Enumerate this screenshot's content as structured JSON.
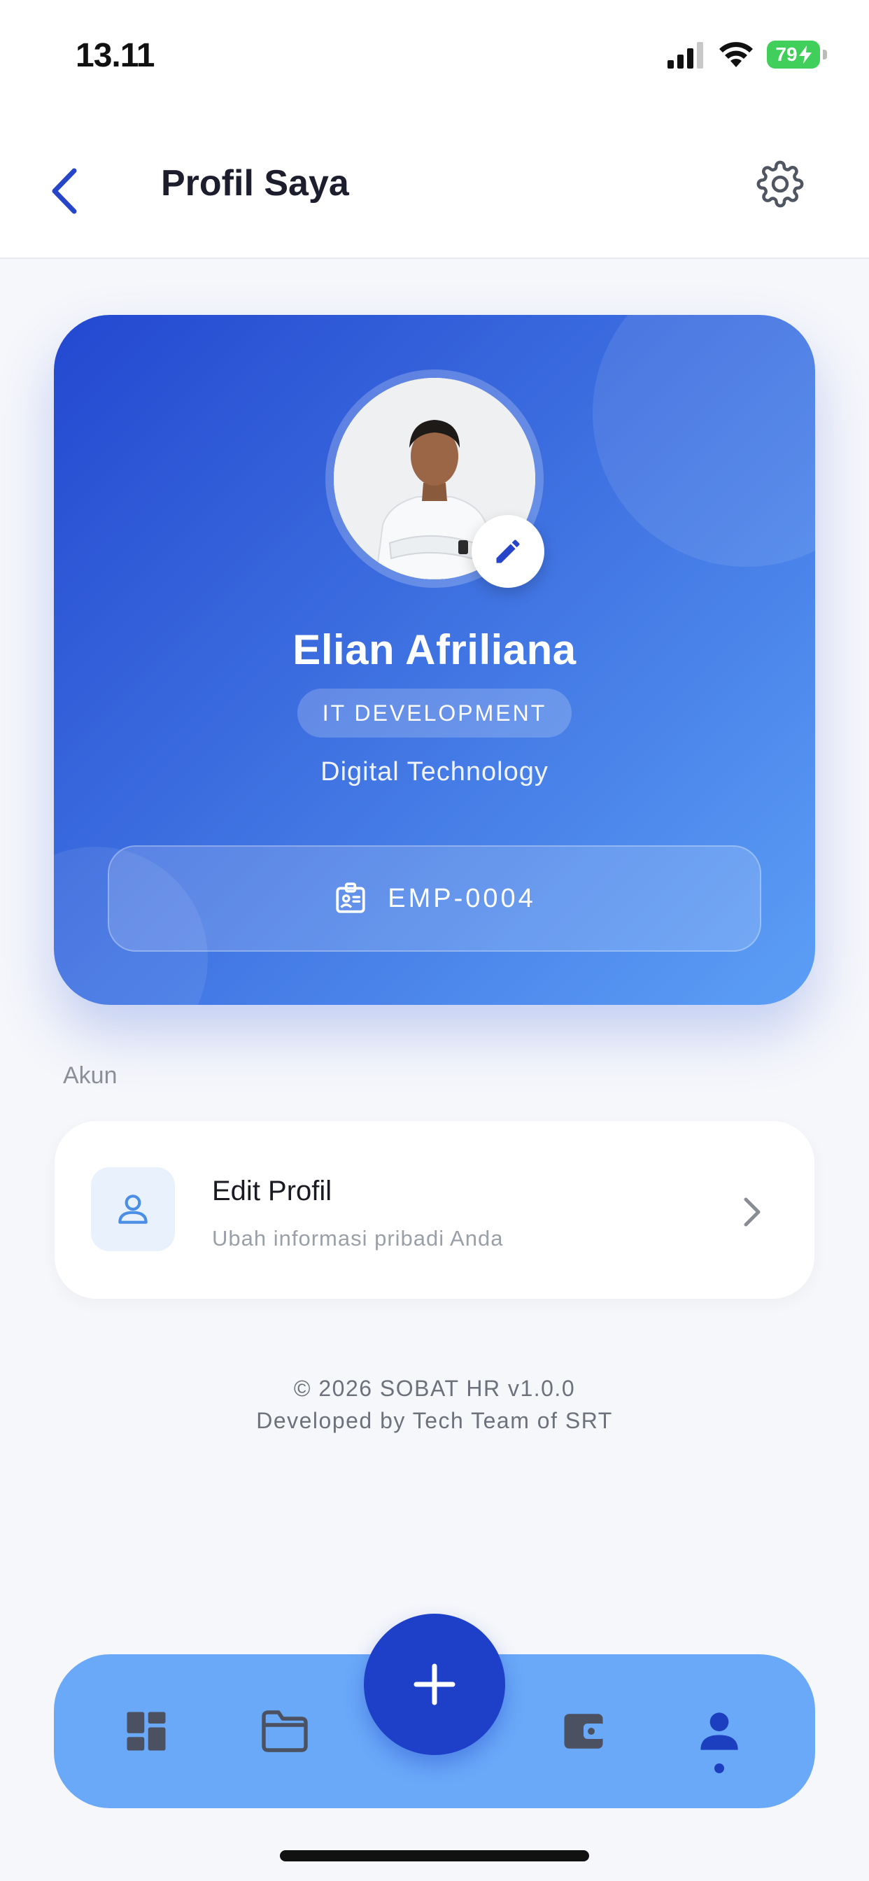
{
  "status_bar": {
    "time": "13.11",
    "battery": "79"
  },
  "header": {
    "title": "Profil Saya"
  },
  "profile": {
    "name": "Elian Afriliana",
    "department": "IT DEVELOPMENT",
    "division": "Digital Technology",
    "employee_id": "EMP-0004"
  },
  "section": {
    "label": "Akun"
  },
  "menu": {
    "edit_profile": {
      "title": "Edit Profil",
      "subtitle": "Ubah informasi pribadi Anda"
    }
  },
  "footer": {
    "copyright": "© 2026 SOBAT HR v1.0.0",
    "developer": "Developed by Tech Team of SRT"
  },
  "bottom_nav": {
    "items": [
      {
        "icon": "dashboard-icon"
      },
      {
        "icon": "folder-icon"
      },
      {
        "icon": "plus-icon"
      },
      {
        "icon": "wallet-icon"
      },
      {
        "icon": "person-icon",
        "active": true
      }
    ]
  },
  "colors": {
    "accent": "#1e40c8",
    "card_gradient_start": "#2348d0",
    "card_gradient_end": "#5c9ff6",
    "nav_bg": "#6aa8f8",
    "battery": "#3fcf5a"
  }
}
